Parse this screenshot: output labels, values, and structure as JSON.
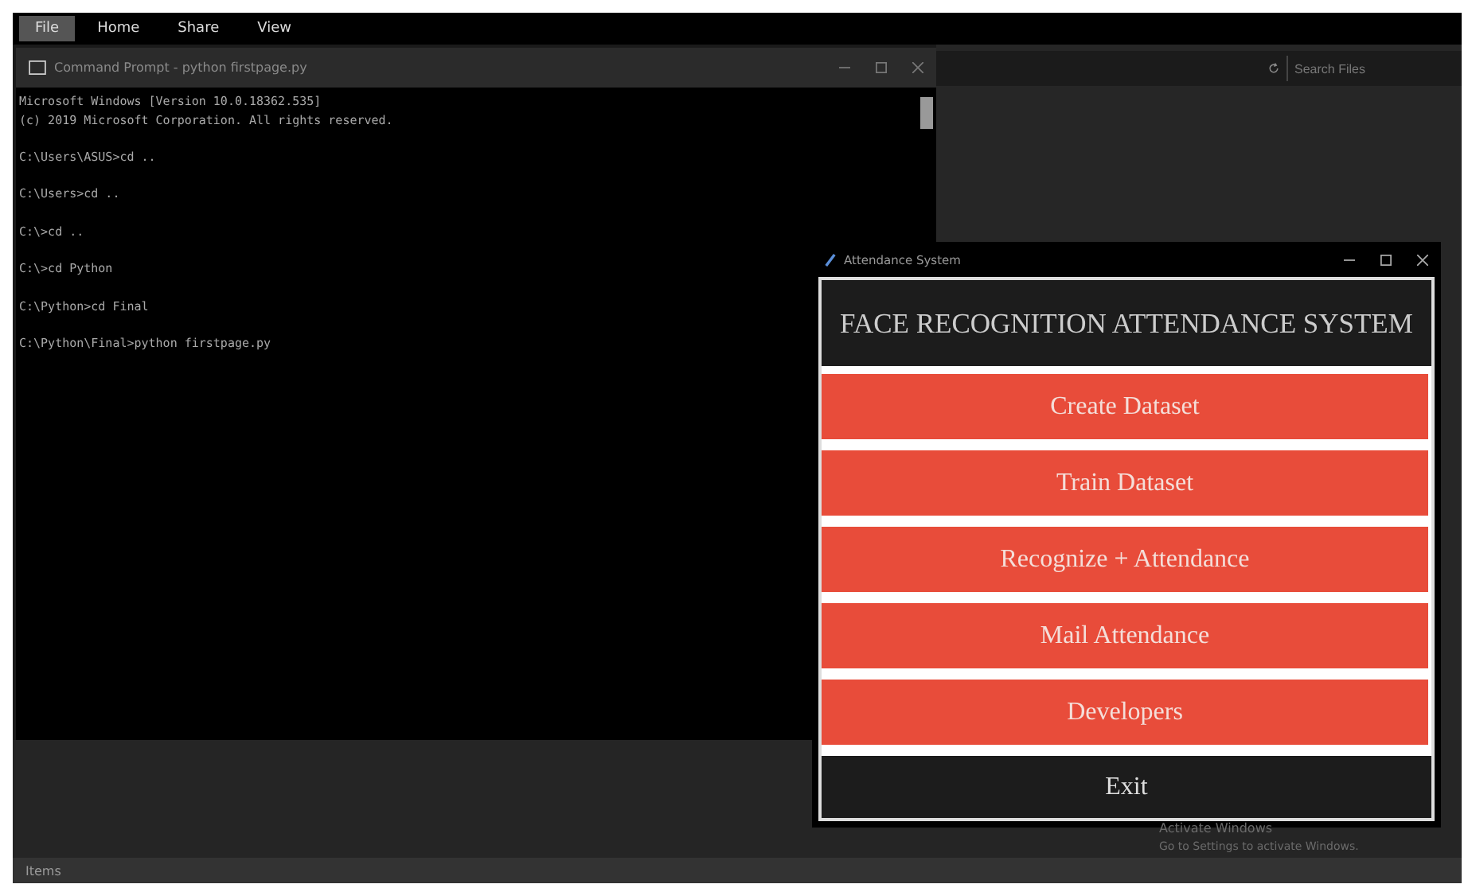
{
  "menu": [
    {
      "label": "File",
      "selected": true
    },
    {
      "label": "Home",
      "selected": false
    },
    {
      "label": "Share",
      "selected": false
    },
    {
      "label": "View",
      "selected": false
    }
  ],
  "explorer": {
    "search": {
      "placeholder": "Search Files"
    },
    "status_bar": "Items"
  },
  "terminal": {
    "title": "Command Prompt - python firstpage.py",
    "blocks": [
      [
        "Microsoft Windows [Version 10.0.18362.535]",
        "(c) 2019 Microsoft Corporation. All rights reserved."
      ],
      [
        "C:\\Users\\ASUS>cd .."
      ],
      [
        "C:\\Users>cd .."
      ],
      [
        "C:\\>cd .."
      ],
      [
        "C:\\>cd Python"
      ],
      [
        "C:\\Python>cd Final"
      ],
      [
        "C:\\Python\\Final>python firstpage.py"
      ]
    ]
  },
  "app": {
    "title": "Attendance System",
    "heading": "FACE RECOGNITION ATTENDANCE SYSTEM",
    "buttons": [
      {
        "label": "Create Dataset",
        "kind": "action"
      },
      {
        "label": "Train Dataset",
        "kind": "action"
      },
      {
        "label": "Recognize + Attendance",
        "kind": "action"
      },
      {
        "label": "Mail Attendance",
        "kind": "action"
      },
      {
        "label": "Developers",
        "kind": "action"
      },
      {
        "label": "Exit",
        "kind": "exit"
      }
    ]
  },
  "activation": {
    "title": "Activate Windows",
    "subtitle": "Go to Settings to activate Windows."
  }
}
